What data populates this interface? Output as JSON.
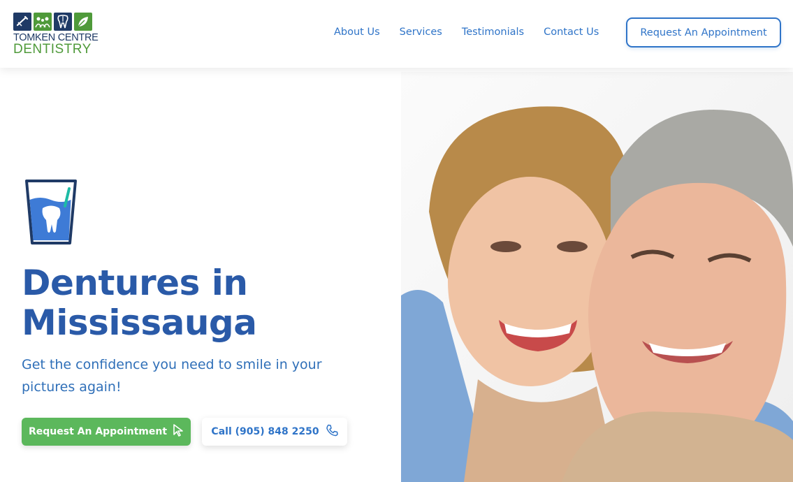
{
  "logo": {
    "line1": "TOMKEN CENTRE",
    "line2": "DENTISTRY",
    "tiles": [
      "toothbrush-icon",
      "family-icon",
      "tooth-icon",
      "leaf-icon"
    ],
    "colors": {
      "navy": "#1f3a66",
      "green": "#4f9a3a"
    }
  },
  "nav": {
    "links": [
      "About Us",
      "Services",
      "Testimonials",
      "Contact Us"
    ],
    "cta": "Request An Appointment"
  },
  "hero": {
    "icon": "water-glass-tooth-icon",
    "title_line1": "Dentures in",
    "title_line2": "Mississauga",
    "subtitle": "Get the confidence you need to smile in your pictures again!",
    "primary_button": "Request An Appointment",
    "primary_icon": "pointer-icon",
    "call_button": "Call (905) 848 2250",
    "call_icon": "phone-icon",
    "image": "smiling-couple-photo"
  },
  "colors": {
    "brand_blue": "#2a5aa8",
    "link_blue": "#2f74c8",
    "button_green": "#5cb85c"
  }
}
